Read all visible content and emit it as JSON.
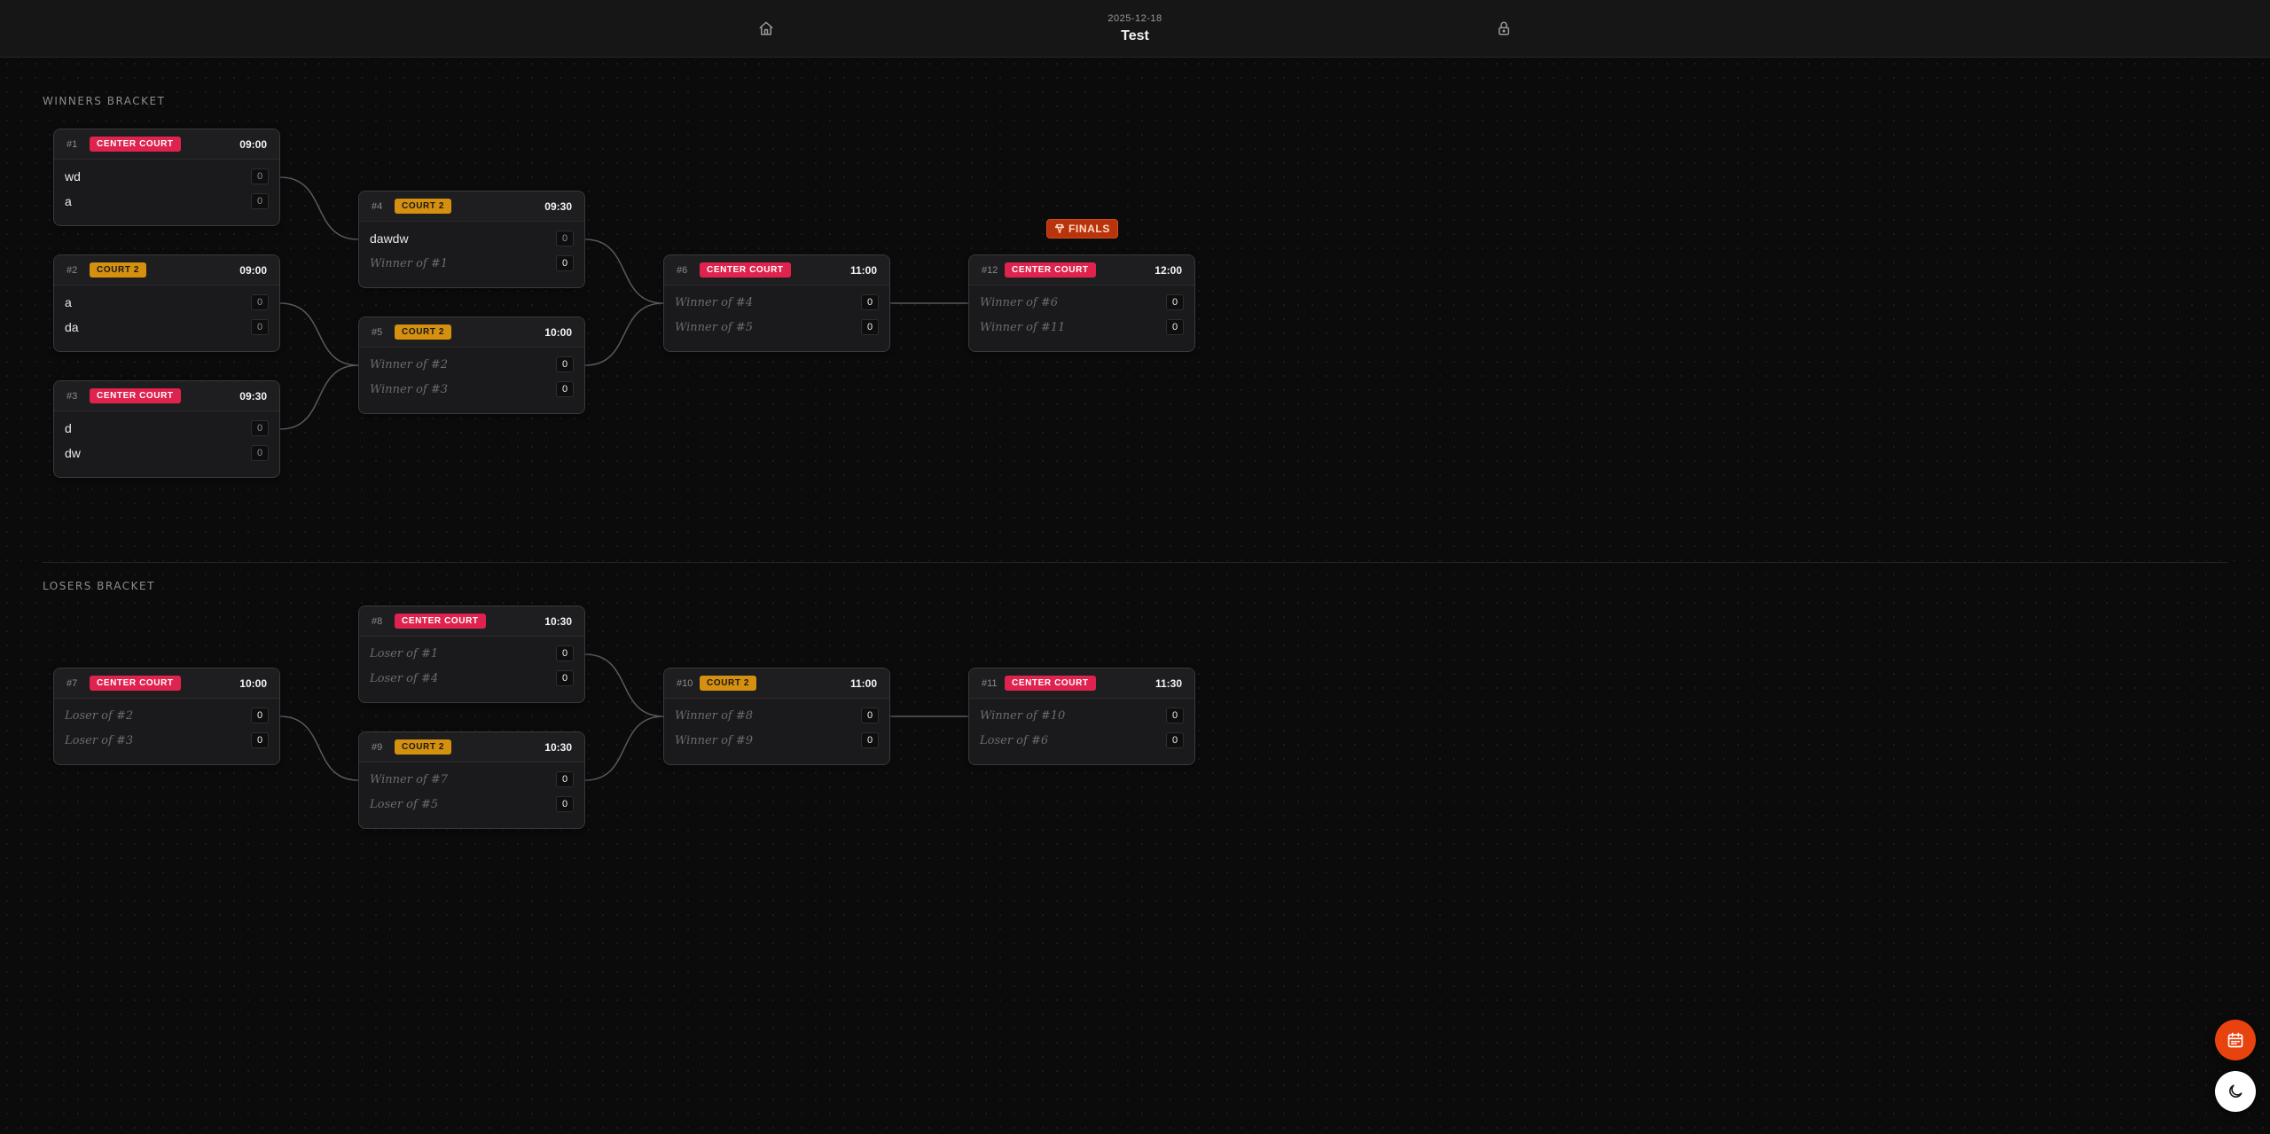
{
  "header": {
    "date": "2025-12-18",
    "title": "Test",
    "left_icon": "home-icon",
    "right_icon": "lock-icon"
  },
  "colors": {
    "center_court": "#e0234e",
    "court_2": "#d4900e",
    "finals": "#b8340c",
    "fab_calendar": "#e8420e"
  },
  "winners_label": "WINNERS BRACKET",
  "losers_label": "LOSERS BRACKET",
  "finals_label": "FINALS",
  "matches": [
    {
      "id": "m1",
      "num": "#1",
      "court": "CENTER COURT",
      "court_type": "center",
      "time": "09:00",
      "teams": [
        {
          "name": "wd",
          "score": "0",
          "placeholder": false
        },
        {
          "name": "a",
          "score": "0",
          "placeholder": false
        }
      ]
    },
    {
      "id": "m2",
      "num": "#2",
      "court": "COURT 2",
      "court_type": "court2",
      "time": "09:00",
      "teams": [
        {
          "name": "a",
          "score": "0",
          "placeholder": false
        },
        {
          "name": "da",
          "score": "0",
          "placeholder": false
        }
      ]
    },
    {
      "id": "m3",
      "num": "#3",
      "court": "CENTER COURT",
      "court_type": "center",
      "time": "09:30",
      "teams": [
        {
          "name": "d",
          "score": "0",
          "placeholder": false
        },
        {
          "name": "dw",
          "score": "0",
          "placeholder": false
        }
      ]
    },
    {
      "id": "m4",
      "num": "#4",
      "court": "COURT 2",
      "court_type": "court2",
      "time": "09:30",
      "teams": [
        {
          "name": "dawdw",
          "score": "0",
          "placeholder": false
        },
        {
          "name": "Winner of #1",
          "score": "0",
          "placeholder": true
        }
      ]
    },
    {
      "id": "m5",
      "num": "#5",
      "court": "COURT 2",
      "court_type": "court2",
      "time": "10:00",
      "teams": [
        {
          "name": "Winner of #2",
          "score": "0",
          "placeholder": true
        },
        {
          "name": "Winner of #3",
          "score": "0",
          "placeholder": true
        }
      ]
    },
    {
      "id": "m6",
      "num": "#6",
      "court": "CENTER COURT",
      "court_type": "center",
      "time": "11:00",
      "teams": [
        {
          "name": "Winner of #4",
          "score": "0",
          "placeholder": true
        },
        {
          "name": "Winner of #5",
          "score": "0",
          "placeholder": true
        }
      ]
    },
    {
      "id": "m12",
      "num": "#12",
      "court": "CENTER COURT",
      "court_type": "center",
      "time": "12:00",
      "teams": [
        {
          "name": "Winner of #6",
          "score": "0",
          "placeholder": true
        },
        {
          "name": "Winner of #11",
          "score": "0",
          "placeholder": true
        }
      ]
    },
    {
      "id": "m8",
      "num": "#8",
      "court": "CENTER COURT",
      "court_type": "center",
      "time": "10:30",
      "teams": [
        {
          "name": "Loser of #1",
          "score": "0",
          "placeholder": true
        },
        {
          "name": "Loser of #4",
          "score": "0",
          "placeholder": true
        }
      ]
    },
    {
      "id": "m7",
      "num": "#7",
      "court": "CENTER COURT",
      "court_type": "center",
      "time": "10:00",
      "teams": [
        {
          "name": "Loser of #2",
          "score": "0",
          "placeholder": true
        },
        {
          "name": "Loser of #3",
          "score": "0",
          "placeholder": true
        }
      ]
    },
    {
      "id": "m9",
      "num": "#9",
      "court": "COURT 2",
      "court_type": "court2",
      "time": "10:30",
      "teams": [
        {
          "name": "Winner of #7",
          "score": "0",
          "placeholder": true
        },
        {
          "name": "Loser of #5",
          "score": "0",
          "placeholder": true
        }
      ]
    },
    {
      "id": "m10",
      "num": "#10",
      "court": "COURT 2",
      "court_type": "court2",
      "time": "11:00",
      "teams": [
        {
          "name": "Winner of #8",
          "score": "0",
          "placeholder": true
        },
        {
          "name": "Winner of #9",
          "score": "0",
          "placeholder": true
        }
      ]
    },
    {
      "id": "m11",
      "num": "#11",
      "court": "CENTER COURT",
      "court_type": "center",
      "time": "11:30",
      "teams": [
        {
          "name": "Winner of #10",
          "score": "0",
          "placeholder": true
        },
        {
          "name": "Loser of #6",
          "score": "0",
          "placeholder": true
        }
      ]
    }
  ],
  "fabs": {
    "calendar_icon": "calendar-icon",
    "theme_icon": "moon-icon"
  }
}
